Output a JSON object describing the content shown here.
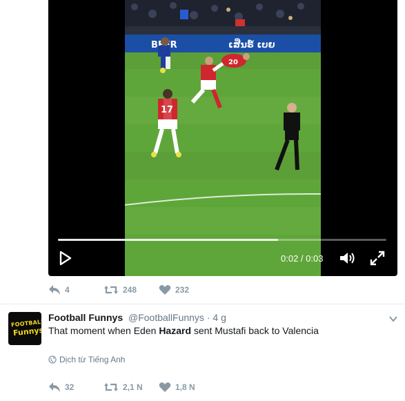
{
  "video": {
    "ad_banner_left": "BEER",
    "ad_banner_right": "ເສີ່ນຣ໌ ເບຍ",
    "player_number": "17",
    "player_number_2": "20",
    "time_current": "0:02",
    "time_total": "0:03",
    "progress": 0.67
  },
  "top_actions": {
    "reply_count": "4",
    "retweet_count": "248",
    "like_count": "232"
  },
  "tweet": {
    "display_name": "Football Funnys",
    "handle": "@FootballFunnys",
    "separator": "·",
    "timestamp": "4 g",
    "text_before": "That moment when Eden ",
    "text_bold": "Hazard",
    "text_after": " sent Mustafi back to Valencia",
    "translate_label": "Dịch từ Tiếng Anh",
    "avatar_top": "FOOTBALL",
    "avatar_bottom": "Funnys",
    "reply_count": "32",
    "retweet_count": "2,1 N",
    "like_count": "1,8 N"
  },
  "colors": {
    "pitch": "#5fa63a",
    "kit_red": "#d0262e",
    "action_gray": "#8899a6"
  },
  "icons": {
    "reply": "reply-icon",
    "retweet": "retweet-icon",
    "like": "heart-icon",
    "play": "play-icon",
    "volume": "volume-icon",
    "fullscreen": "fullscreen-icon",
    "globe": "globe-icon",
    "caret": "chevron-down-icon"
  }
}
